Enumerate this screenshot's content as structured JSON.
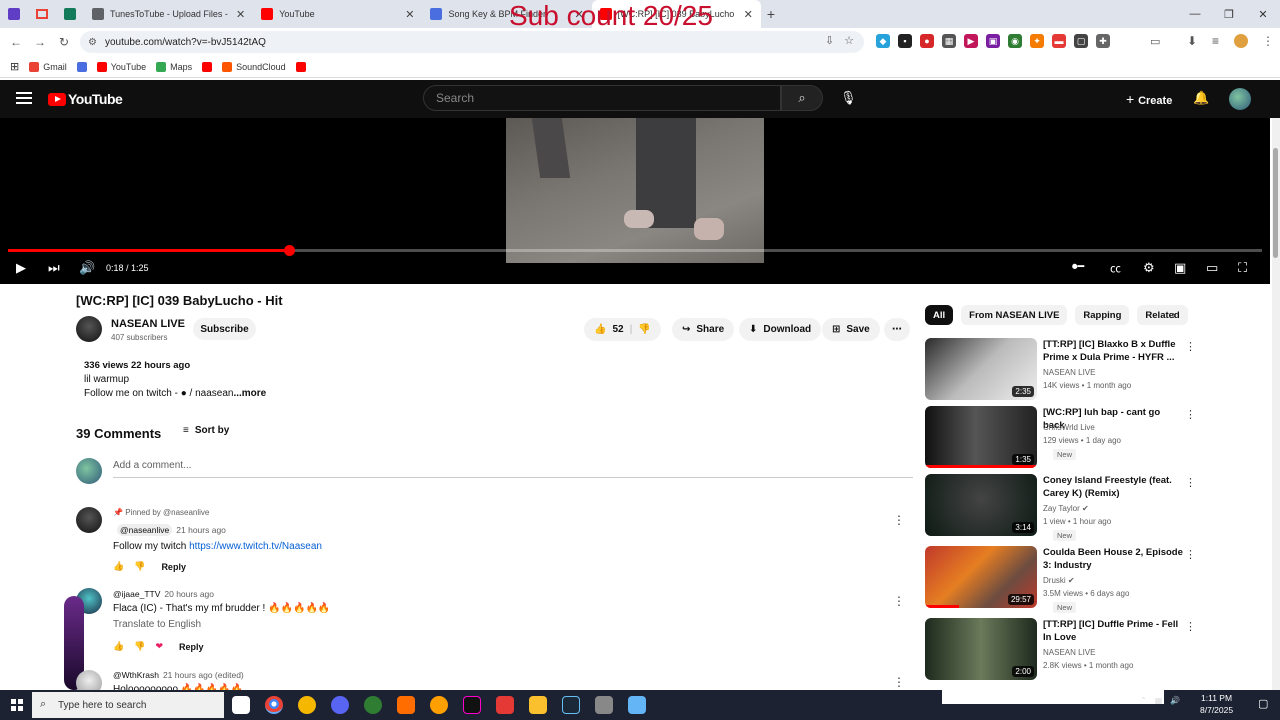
{
  "overlay": "Sub count 20/25",
  "browser": {
    "tabs": [
      {
        "title": "TunesToTube - Upload Files - Li",
        "color": "#5f6368"
      },
      {
        "title": "YouTube",
        "color": "#ff0000"
      },
      {
        "title": "Song Key & BPM Finder",
        "color": "#4a6ee0"
      },
      {
        "title": "[WC:RP] [IC] 039 BabyLucho",
        "color": "#ff0000"
      }
    ],
    "url": "youtube.com/watch?v=-bvJ5142tAQ",
    "bookmarks": [
      {
        "label": "Gmail",
        "color": "#ea4335"
      },
      {
        "label": "",
        "color": "#4a6ee0"
      },
      {
        "label": "YouTube",
        "color": "#ff0000"
      },
      {
        "label": "Maps",
        "color": "#34a853"
      },
      {
        "label": "",
        "color": "#ff0000"
      },
      {
        "label": "SoundCloud",
        "color": "#ff5500"
      },
      {
        "label": "",
        "color": "#ff0000"
      }
    ]
  },
  "header": {
    "logo": "YouTube",
    "search_placeholder": "Search",
    "create_label": "Create"
  },
  "player": {
    "time": "0:18 / 1:25",
    "progress_fraction": 0.224
  },
  "video": {
    "title": "[WC:RP] [IC] 039 BabyLucho - Hit",
    "channel": "NASEAN LIVE",
    "subscribers": "407 subscribers",
    "subscribe_label": "Subscribe",
    "likes": "52",
    "share_label": "Share",
    "download_label": "Download",
    "save_label": "Save",
    "stats": "336 views  22 hours ago",
    "desc_line1": "lil warmup",
    "desc_line2": "Follow me on twitch -  ● / naasean",
    "more_label": "...more"
  },
  "comments": {
    "heading": "39 Comments",
    "sort_label": "Sort by",
    "add_placeholder": "Add a comment...",
    "reply_label": "Reply",
    "items": [
      {
        "pinned": "Pinned by @naseanlive",
        "author": "@naseanlive",
        "ago": "21 hours ago",
        "text": "Follow my twitch ",
        "link": "https://www.twitch.tv/Naasean"
      },
      {
        "author": "@ijaae_TTV",
        "ago": "20 hours ago",
        "text": "Flaca (IC) - That's my mf brudder ! 🔥🔥🔥🔥🔥",
        "translate": "Translate to English"
      },
      {
        "author": "@WthKrash",
        "ago": "21 hours ago (edited)",
        "text": "Holooooooooo 🔥🔥🔥🔥🔥"
      }
    ]
  },
  "sidebar": {
    "chips": [
      "All",
      "From NASEAN LIVE",
      "Rapping",
      "Related"
    ],
    "recs": [
      {
        "title": "[TT:RP] [IC] Blaxko B x Duffle Prime x Dula Prime - HYFR ...",
        "channel": "NASEAN LIVE",
        "views": "14K views • 1 month ago",
        "duration": "2:35",
        "badge": ""
      },
      {
        "title": "[WC:RP] luh bap - cant go back",
        "channel": "ChrisWrld Live",
        "views": "129 views • 1 day ago",
        "duration": "1:35",
        "badge": "New"
      },
      {
        "title": "Coney Island Freestyle (feat. Carey K) (Remix)",
        "channel": "Zay Taylor",
        "views": "1 view • 1 hour ago",
        "duration": "3:14",
        "badge": "New"
      },
      {
        "title": "Coulda Been House 2, Episode 3: Industry",
        "channel": "Druski",
        "views": "3.5M views • 6 days ago",
        "duration": "29:57",
        "badge": "New"
      },
      {
        "title": "[TT:RP] [IC] Duffle Prime - Fell In Love",
        "channel": "NASEAN LIVE",
        "views": "2.8K views • 1 month ago",
        "duration": "2:00",
        "badge": ""
      }
    ]
  },
  "taskbar": {
    "search_placeholder": "Type here to search",
    "time": "1:11 PM",
    "date": "8/7/2025"
  }
}
